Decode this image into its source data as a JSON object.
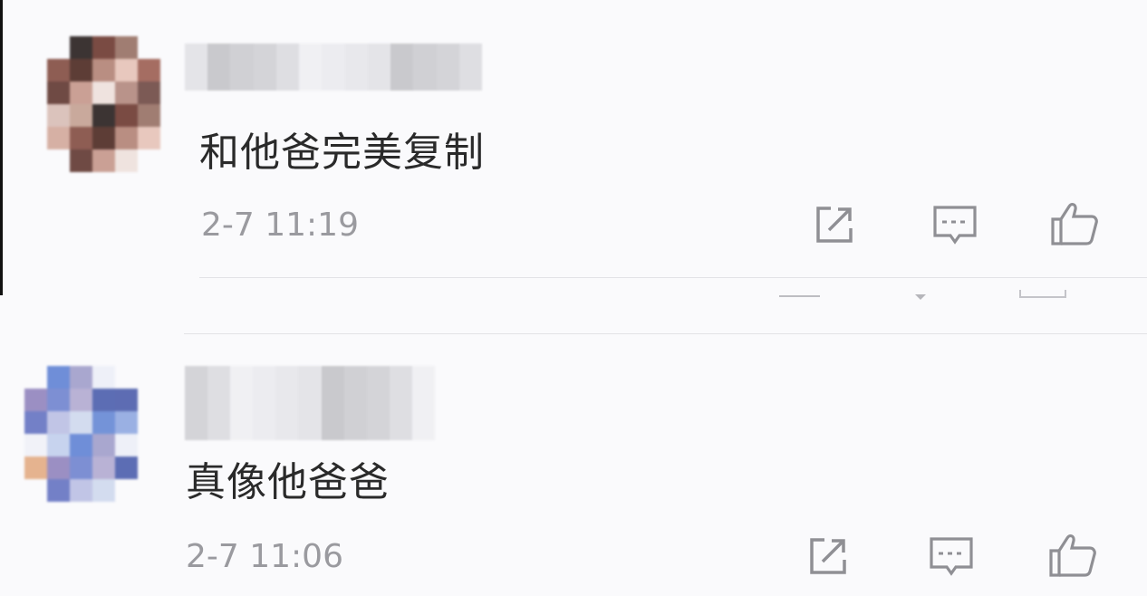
{
  "comments": [
    {
      "username": "",
      "text": "和他爸完美复制",
      "time": "2-7 11:19",
      "actions": {
        "share": "share-icon",
        "reply": "reply-icon",
        "like": "thumbs-up-icon"
      },
      "avatar_colors": [
        "#c9a99c",
        "#3c3433",
        "#7a4b43",
        "#a07d72",
        "#d6b0a4",
        "#8e5d53",
        "#5d3d36",
        "#b98e82",
        "#e8c8be",
        "#a56d62",
        "#6f4a44",
        "#caa095",
        "#efe3df",
        "#b9938a",
        "#7c5a55",
        "#dbc3bc"
      ]
    },
    {
      "username": "",
      "text": "真像他爸爸",
      "time": "2-7 11:06",
      "actions": {
        "share": "share-icon",
        "reply": "reply-icon",
        "like": "thumbs-up-icon"
      },
      "avatar_colors": [
        "#c7d3ee",
        "#6f8ed8",
        "#a9a7cf",
        "#eef0f8",
        "#e5b38f",
        "#9b8fc3",
        "#7d8fd3",
        "#b9b2d5",
        "#5c6db4",
        "#5d6cb3",
        "#7380c7",
        "#c1c5e6",
        "#d3dcef",
        "#7493d8",
        "#9ab0e3",
        "#f1f2f8"
      ]
    }
  ],
  "colors": {
    "background": "#fafafc",
    "text": "#2a2a2a",
    "meta": "#9a9a9f",
    "icon": "#8f8f94",
    "divider": "#e2e2e6"
  }
}
